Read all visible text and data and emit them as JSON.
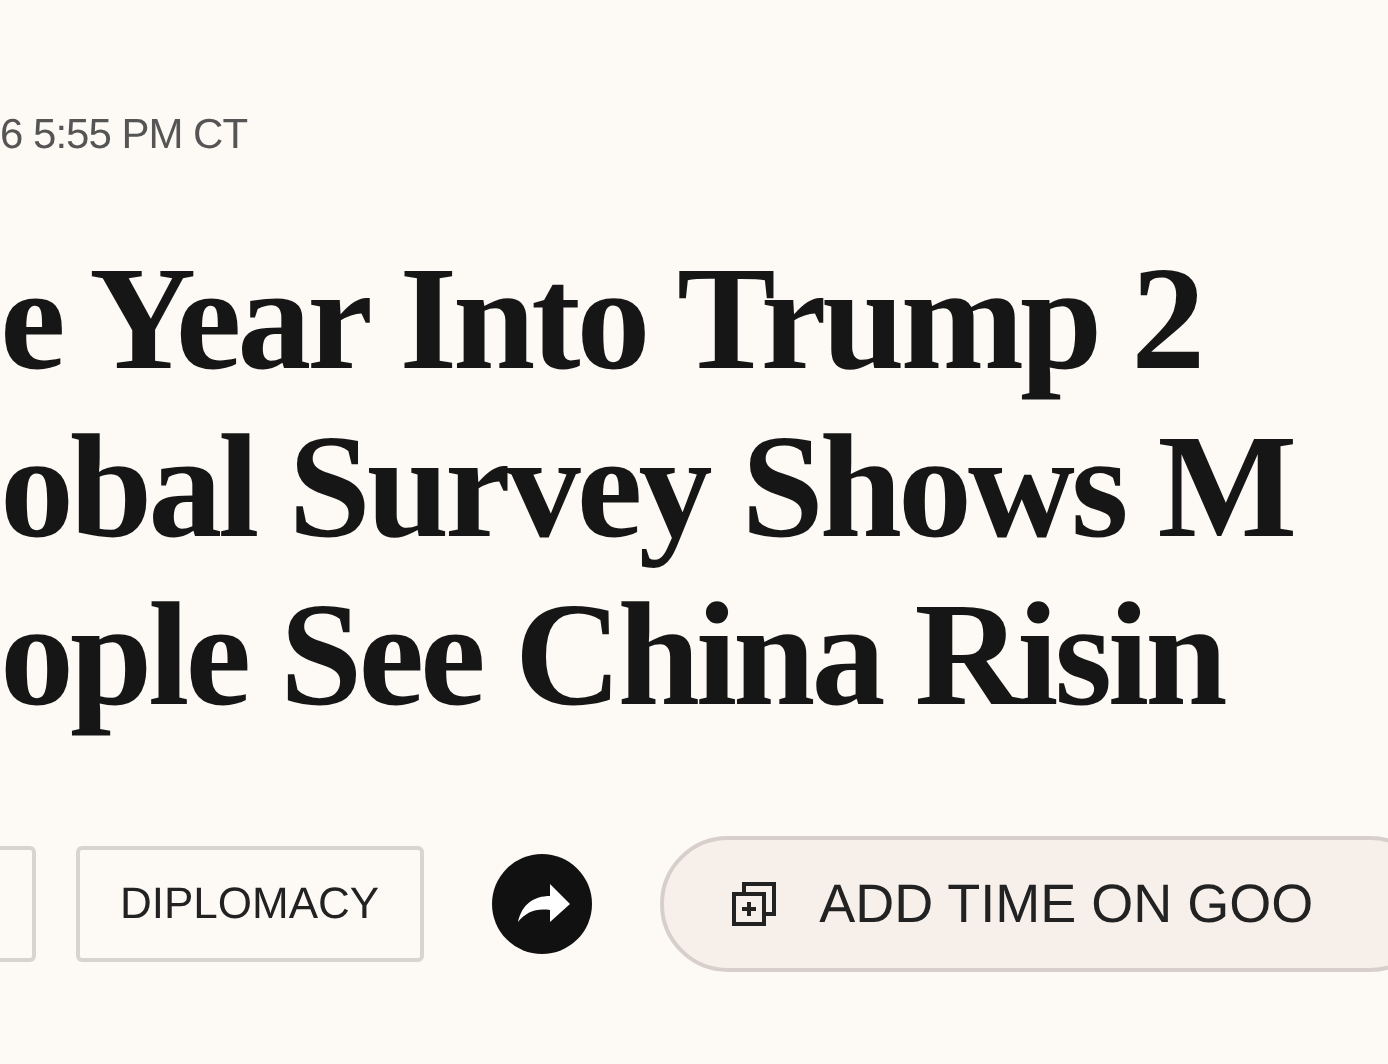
{
  "timestamp": "6 5:55 PM CT",
  "headline": [
    "e Year Into Trump 2",
    "obal Survey Shows M",
    "ople See China Risin"
  ],
  "actions": {
    "tags": [
      {
        "kind": "partial"
      },
      {
        "kind": "full",
        "label": "DIPLOMACY"
      }
    ],
    "share": {
      "kind": "share"
    },
    "calendar_button": {
      "label": "ADD TIME ON GOO"
    }
  }
}
